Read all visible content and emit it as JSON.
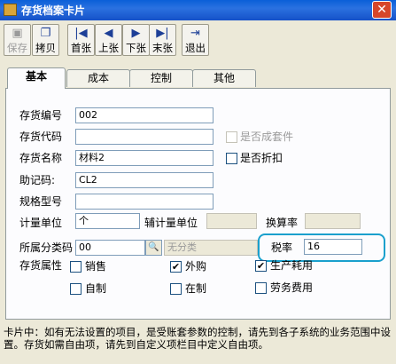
{
  "window": {
    "title": "存货档案卡片",
    "close": "✕"
  },
  "toolbar": [
    {
      "label": "保存",
      "icon": "save-icon",
      "enabled": false
    },
    {
      "label": "拷贝",
      "icon": "copy-icon",
      "enabled": true
    },
    {
      "label": "首张",
      "icon": "first-icon",
      "enabled": true
    },
    {
      "label": "上张",
      "icon": "prev-icon",
      "enabled": true
    },
    {
      "label": "下张",
      "icon": "next-icon",
      "enabled": true
    },
    {
      "label": "末张",
      "icon": "last-icon",
      "enabled": true
    },
    {
      "label": "退出",
      "icon": "exit-icon",
      "enabled": true
    }
  ],
  "tabs": [
    "基本",
    "成本",
    "控制",
    "其他"
  ],
  "active_tab": "基本",
  "form": {
    "code_label": "存货编号",
    "code_value": "002",
    "alias_label": "存货代码",
    "alias_value": "",
    "name_label": "存货名称",
    "name_value": "材料2",
    "mnemonic_label": "助记码:",
    "mnemonic_value": "CL2",
    "spec_label": "规格型号",
    "spec_value": "",
    "unit_label": "计量单位",
    "unit_value": "个",
    "aux_unit_label": "辅计量单位",
    "aux_unit_value": "",
    "rate_label": "换算率",
    "rate_value": "",
    "category_label": "所属分类码",
    "category_value": "00",
    "category_name": "无分类",
    "tax_label": "税率",
    "tax_value": "16",
    "attr_label": "存货属性",
    "kit_label": "是否成套件",
    "kit_checked": false,
    "discount_label": "是否折扣",
    "discount_checked": false,
    "attrs": {
      "sale": {
        "label": "销售",
        "checked": false
      },
      "purchase": {
        "label": "外购",
        "checked": true
      },
      "production": {
        "label": "生产耗用",
        "checked": true
      },
      "self_made": {
        "label": "自制",
        "checked": false
      },
      "wip": {
        "label": "在制",
        "checked": false
      },
      "labor": {
        "label": "劳务费用",
        "checked": false
      }
    }
  },
  "footer_text": "卡片中：如有无法设置的项目，是受账套参数的控制，请先到各子系统的业务范围中设置。存货如需自由项，请先到自定义项栏目中定义自由项。",
  "colors": {
    "titlebar": "#0a5fd8",
    "highlight": "#1aa0cd",
    "panel": "#fcfcfe"
  }
}
